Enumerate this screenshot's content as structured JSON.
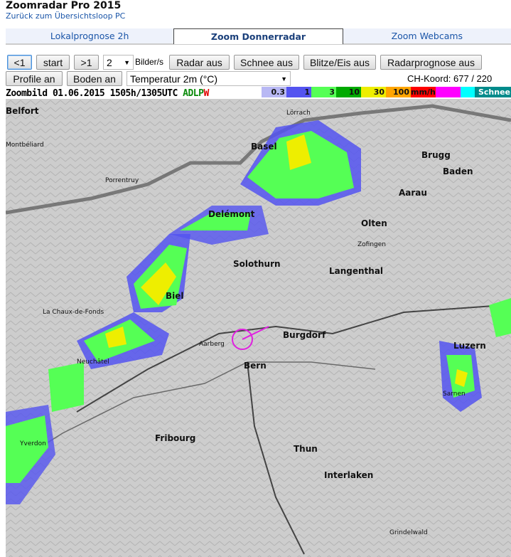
{
  "app_title": "Zoomradar Pro 2015",
  "back_link": "Zurück zum Übersichtsloop PC",
  "tabs": [
    "Lokalprognose 2h",
    "Zoom Donnerradar",
    "Zoom Webcams"
  ],
  "controls": {
    "prev": "<1",
    "start": "start",
    "next": ">1",
    "speed": "2",
    "speed_unit": "Bilder/s",
    "radar": "Radar aus",
    "snow": "Schnee aus",
    "lightning": "Blitze/Eis aus",
    "forecast": "Radarprognose aus",
    "profile": "Profile an",
    "ground": "Boden an",
    "layer": "Temperatur 2m (°C)",
    "coord": "CH-Koord: 677 / 220"
  },
  "info": {
    "label": "Zoombild",
    "date": "01.06.2015",
    "time": "1505h/1305UTC",
    "adlp": "ADLP",
    "w": "W"
  },
  "legend": [
    {
      "label": "0.3",
      "color": "#b8b8f4"
    },
    {
      "label": "1",
      "color": "#5454f0"
    },
    {
      "label": "3",
      "color": "#55ff55"
    },
    {
      "label": "10",
      "color": "#00aa00"
    },
    {
      "label": "30",
      "color": "#eeee00"
    },
    {
      "label": "100",
      "color": "#ffa500"
    },
    {
      "label": "mm/h",
      "color": "#ff0000"
    },
    {
      "label": "",
      "color": "#ff00ff"
    },
    {
      "label": "",
      "color": "#00ffff"
    },
    {
      "label": "Schnee",
      "color": "#008b8b"
    },
    {
      "label": "",
      "color": "#005555"
    }
  ],
  "places": {
    "basel": "Basel",
    "bern": "Bern",
    "biel": "Biel",
    "solothurn": "Solothurn",
    "olten": "Olten",
    "aarau": "Aarau",
    "brugg": "Brugg",
    "baden": "Baden",
    "thun": "Thun",
    "interlaken": "Interlaken",
    "fribourg": "Fribourg",
    "delemont": "Delémont",
    "burgdorf": "Burgdorf",
    "langenthal": "Langenthal",
    "loerrach": "Lörrach",
    "belfort": "Belfort",
    "montbeliard": "Montbéliard",
    "chauxdefonds": "La Chaux-de-Fonds",
    "neuchatel": "Neuchâtel",
    "yverdon": "Yverdon",
    "luzern": "Luzern",
    "zofingen": "Zofingen",
    "sarnen": "Sarnen",
    "porrentruy": "Porrentruy",
    "aarberg": "Aarberg",
    "grindelwald": "Grindelwald"
  }
}
